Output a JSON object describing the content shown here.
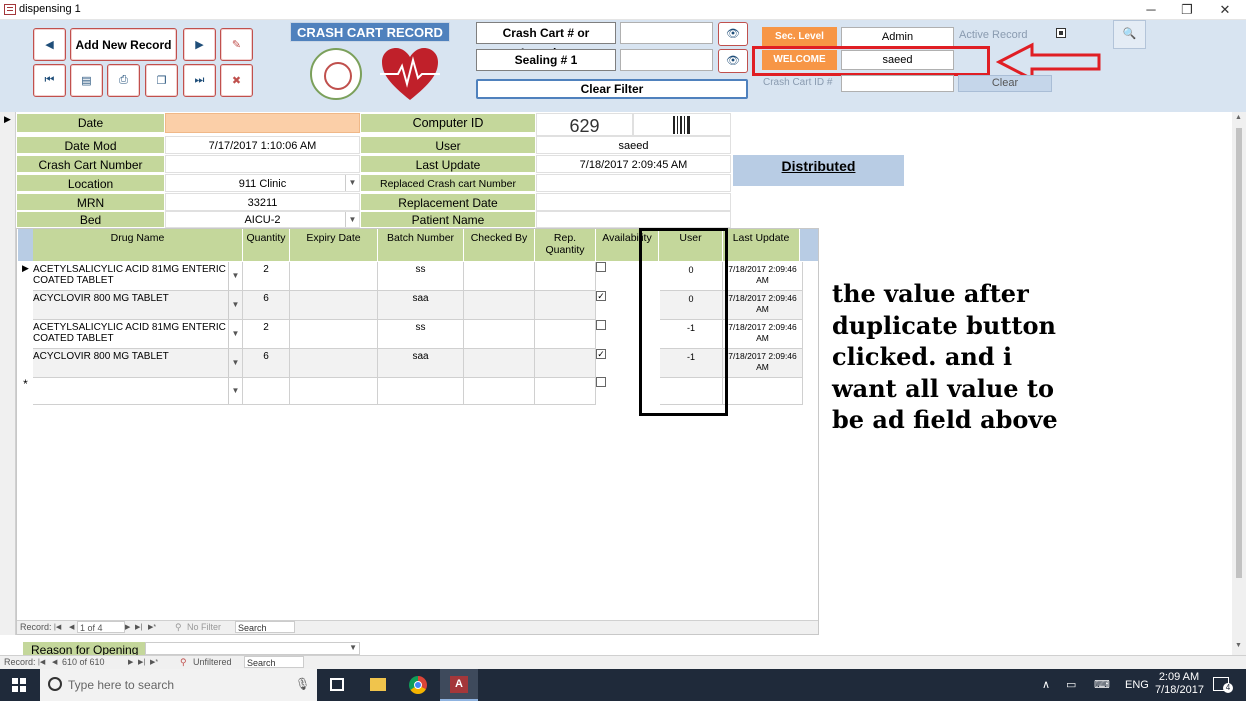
{
  "window": {
    "title": "dispensing 1",
    "minimize": "─",
    "restore": "❐",
    "close": "✕"
  },
  "header": {
    "add_new_record": "Add New Record",
    "form_title": "CRASH CART RECORD",
    "crash_cart_label": "Crash Cart # or Location",
    "sealing_label": "Sealing  # 1",
    "clear_filter": "Clear Filter",
    "sec_level_label": "Sec. Level",
    "sec_level_value": "Admin",
    "welcome_label": "WELCOME",
    "welcome_value": "saeed",
    "active_record_label": "Active Record",
    "crash_cart_id_label": "Crash Cart ID #",
    "clear_button": "Clear"
  },
  "form": {
    "date_label": "Date",
    "computer_id_label": "Computer ID",
    "computer_id_value": "629",
    "date_mod_label": "Date Mod",
    "date_mod_value": "7/17/2017 1:10:06 AM",
    "user_label": "User",
    "user_value": "saeed",
    "crash_cart_number_label": "Crash Cart Number",
    "last_update_label": "Last Update",
    "last_update_value": "7/18/2017 2:09:45 AM",
    "status": "Distributed",
    "location_label": "Location",
    "location_value": "911 Clinic",
    "replaced_label": "Replaced Crash cart Number",
    "mrn_label": "MRN",
    "mrn_value": "33211",
    "replacement_date_label": "Replacement Date",
    "bed_label": "Bed",
    "bed_value": "AICU-2",
    "patient_name_label": "Patient Name"
  },
  "grid": {
    "columns": [
      "Drug Name",
      "Quantity",
      "Expiry Date",
      "Batch Number",
      "Checked By",
      "Rep. Quantity",
      "Availability",
      "User",
      "Last Update"
    ],
    "rows": [
      {
        "drug_line1": "ACETYLSALICYLIC ACID 81MG ENTERIC",
        "drug_line2": "COATED TABLET",
        "qty": "2",
        "batch": "ss",
        "checked": false,
        "user": "0",
        "upd1": "7/18/2017 2:09:46",
        "upd2": "AM"
      },
      {
        "drug_line1": "ACYCLOVIR 800 MG TABLET",
        "drug_line2": "",
        "qty": "6",
        "batch": "saa",
        "checked": true,
        "user": "0",
        "upd1": "7/18/2017 2:09:46",
        "upd2": "AM"
      },
      {
        "drug_line1": "ACETYLSALICYLIC ACID 81MG ENTERIC",
        "drug_line2": "COATED TABLET",
        "qty": "2",
        "batch": "ss",
        "checked": false,
        "user": "-1",
        "upd1": "7/18/2017 2:09:46",
        "upd2": "AM"
      },
      {
        "drug_line1": "ACYCLOVIR 800 MG TABLET",
        "drug_line2": "",
        "qty": "6",
        "batch": "saa",
        "checked": true,
        "user": "-1",
        "upd1": "7/18/2017 2:09:46",
        "upd2": "AM"
      }
    ],
    "new_row_marker": "*",
    "current_row_marker": "▶"
  },
  "sub_nav": {
    "record_label": "Record:",
    "position": "1 of 4",
    "filter": "No Filter",
    "search": "Search"
  },
  "reason_label": "Reason for Opening",
  "main_nav": {
    "record_label": "Record:",
    "position": "610 of 610",
    "filter": "Unfiltered",
    "search": "Search"
  },
  "annotation": "the value after duplicate button clicked. and i want all value to be ad field above",
  "taskbar": {
    "search_placeholder": "Type here to search",
    "lang": "ENG",
    "time": "2:09 AM",
    "date": "7/18/2017",
    "notif_count": "4"
  },
  "colors": {
    "accent_blue": "#4f81bd",
    "green_label": "#c4d79b",
    "orange": "#f79646",
    "header_band": "#d8e4f1",
    "annotation_red": "#e01e24"
  }
}
